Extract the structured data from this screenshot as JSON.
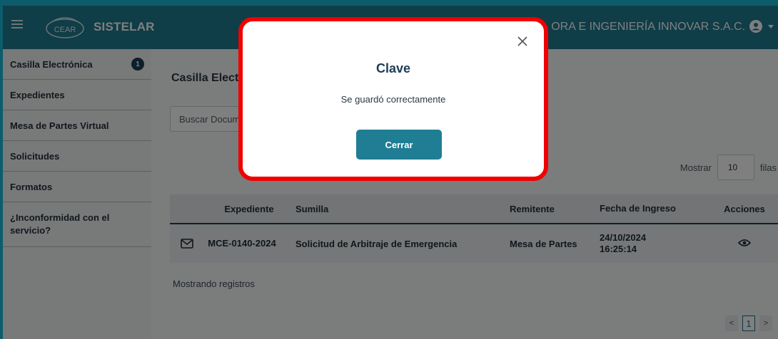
{
  "header": {
    "brand": "SISTELAR",
    "logo_text": "CEAR",
    "company": "ORA E INGENIERÍA INNOVAR S.A.C."
  },
  "sidebar": {
    "items": [
      {
        "label": "Casilla Electrónica",
        "badge": "1"
      },
      {
        "label": "Expedientes"
      },
      {
        "label": "Mesa de Partes Virtual"
      },
      {
        "label": "Solicitudes"
      },
      {
        "label": "Formatos"
      },
      {
        "label": "¿Inconformidad con el servicio?"
      }
    ]
  },
  "main": {
    "title": "Casilla Electr",
    "search_placeholder": "Buscar Docum",
    "show_label": "Mostrar",
    "show_value": "10",
    "show_suffix": "filas",
    "columns": [
      "Expediente",
      "Sumilla",
      "Remitente",
      "Fecha de Ingreso",
      "Acciones"
    ],
    "rows": [
      {
        "expediente": "MCE-0140-2024",
        "sumilla": "Solicitud de Arbitraje de Emergencia",
        "remitente": "Mesa de Partes",
        "fecha": "24/10/2024 16:25:14"
      }
    ],
    "showing_text": "Mostrando registros",
    "pager": {
      "prev": "<",
      "page": "1",
      "next": ">"
    }
  },
  "modal": {
    "title": "Clave",
    "message": "Se guardó correctamente",
    "button": "Cerrar"
  },
  "colors": {
    "header": "#1e7a90",
    "accent": "#1f7e94",
    "highlight_border": "#f00000",
    "badge": "#1c3e55"
  }
}
